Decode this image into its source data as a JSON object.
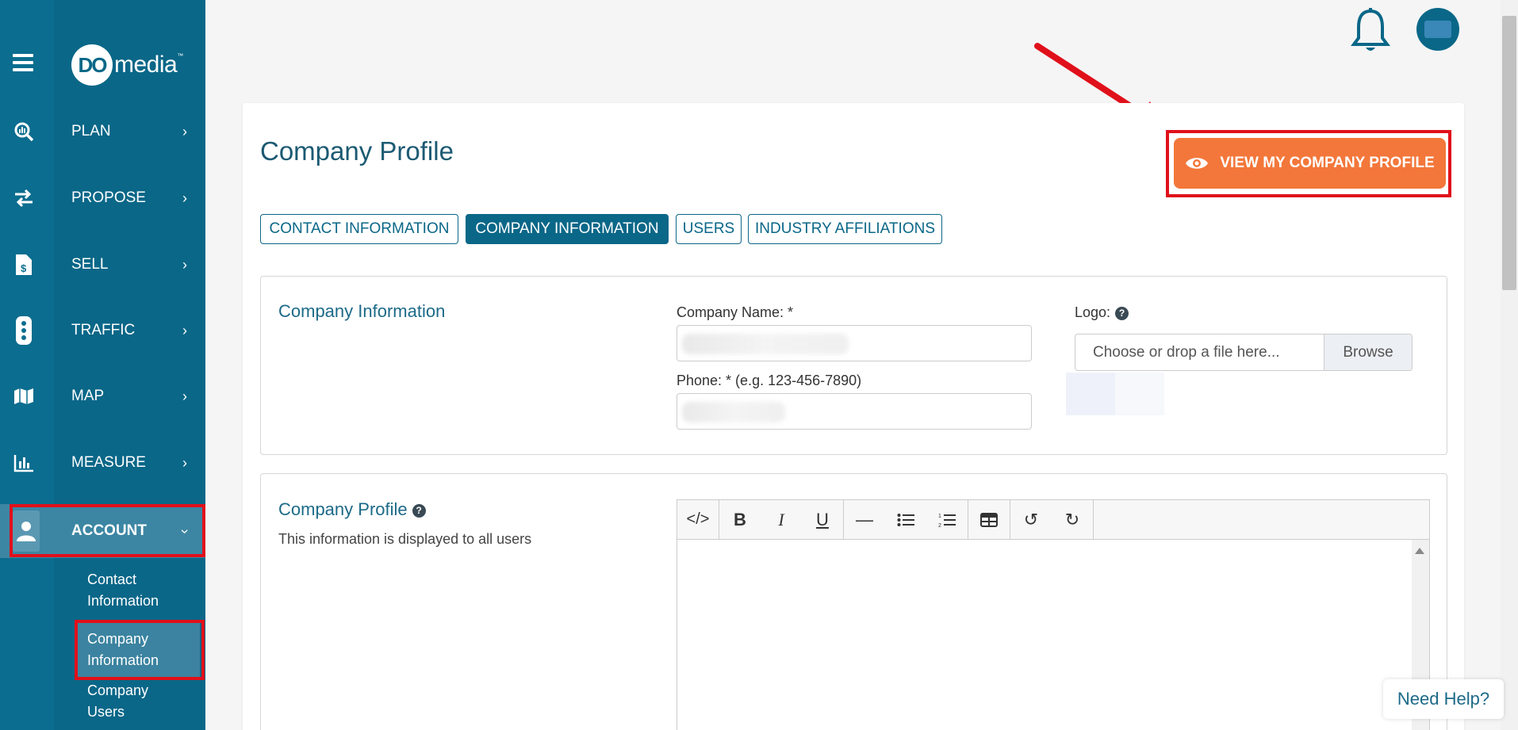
{
  "brand": {
    "logo_mark": "DO",
    "logo_text": "media",
    "logo_tm": "™"
  },
  "nav": {
    "items": [
      {
        "label": "PLAN",
        "icon": "plan-icon"
      },
      {
        "label": "PROPOSE",
        "icon": "propose-icon"
      },
      {
        "label": "SELL",
        "icon": "sell-icon"
      },
      {
        "label": "TRAFFIC",
        "icon": "traffic-icon"
      },
      {
        "label": "MAP",
        "icon": "map-icon"
      },
      {
        "label": "MEASURE",
        "icon": "measure-icon"
      },
      {
        "label": "ACCOUNT",
        "icon": "account-icon"
      }
    ],
    "account_sub": [
      {
        "line1": "Contact",
        "line2": "Information"
      },
      {
        "line1": "Company",
        "line2": "Information"
      },
      {
        "line1": "Company",
        "line2": "Users"
      }
    ]
  },
  "page": {
    "title": "Company Profile",
    "view_button": "VIEW MY COMPANY PROFILE",
    "tabs": [
      "CONTACT INFORMATION",
      "COMPANY INFORMATION",
      "USERS",
      "INDUSTRY AFFILIATIONS"
    ]
  },
  "company_info": {
    "section_title": "Company Information",
    "name_label": "Company Name: *",
    "phone_label": "Phone: * (e.g. 123-456-7890)",
    "logo_label": "Logo:",
    "logo_help": "?",
    "file_placeholder": "Choose or drop a file here...",
    "browse_label": "Browse"
  },
  "company_profile": {
    "section_title": "Company Profile",
    "help": "?",
    "subtitle": "This information is displayed to all users",
    "toolbar": {
      "code": "</>",
      "bold": "B",
      "italic": "I",
      "underline": "U",
      "hr": "—",
      "ul": "ul",
      "ol": "ol",
      "table": "table",
      "undo": "↺",
      "redo": "↻"
    }
  },
  "help_widget": {
    "label": "Need Help?"
  }
}
